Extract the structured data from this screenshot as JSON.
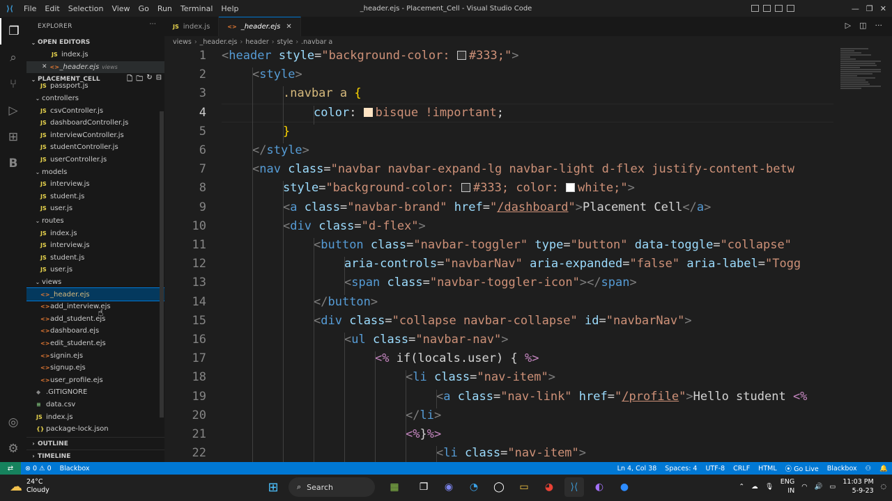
{
  "titlebar": {
    "menu": [
      "File",
      "Edit",
      "Selection",
      "View",
      "Go",
      "Run",
      "Terminal",
      "Help"
    ],
    "title": "_header.ejs - Placement_Cell - Visual Studio Code"
  },
  "explorer": {
    "header": "EXPLORER",
    "open_editors_label": "OPEN EDITORS",
    "open_editors": [
      {
        "name": "index.js",
        "type": "JS"
      },
      {
        "name": "_header.ejs",
        "type": "<>",
        "detail": "views"
      }
    ],
    "project_label": "PLACEMENT_CELL",
    "tree": [
      {
        "name": "passport.js",
        "type": "JS",
        "indent": 2
      },
      {
        "name": "controllers",
        "type": "folder",
        "indent": 1
      },
      {
        "name": "csvController.js",
        "type": "JS",
        "indent": 2
      },
      {
        "name": "dashboardController.js",
        "type": "JS",
        "indent": 2
      },
      {
        "name": "interviewController.js",
        "type": "JS",
        "indent": 2
      },
      {
        "name": "studentController.js",
        "type": "JS",
        "indent": 2
      },
      {
        "name": "userController.js",
        "type": "JS",
        "indent": 2
      },
      {
        "name": "models",
        "type": "folder",
        "indent": 1
      },
      {
        "name": "interview.js",
        "type": "JS",
        "indent": 2
      },
      {
        "name": "student.js",
        "type": "JS",
        "indent": 2
      },
      {
        "name": "user.js",
        "type": "JS",
        "indent": 2
      },
      {
        "name": "routes",
        "type": "folder",
        "indent": 1
      },
      {
        "name": "index.js",
        "type": "JS",
        "indent": 2
      },
      {
        "name": "interview.js",
        "type": "JS",
        "indent": 2
      },
      {
        "name": "student.js",
        "type": "JS",
        "indent": 2
      },
      {
        "name": "user.js",
        "type": "JS",
        "indent": 2
      },
      {
        "name": "views",
        "type": "folder",
        "indent": 1
      },
      {
        "name": "_header.ejs",
        "type": "<>",
        "indent": 2,
        "selected": true
      },
      {
        "name": "add_interview.ejs",
        "type": "<>",
        "indent": 2
      },
      {
        "name": "add_student.ejs",
        "type": "<>",
        "indent": 2
      },
      {
        "name": "dashboard.ejs",
        "type": "<>",
        "indent": 2
      },
      {
        "name": "edit_student.ejs",
        "type": "<>",
        "indent": 2
      },
      {
        "name": "signin.ejs",
        "type": "<>",
        "indent": 2
      },
      {
        "name": "signup.ejs",
        "type": "<>",
        "indent": 2
      },
      {
        "name": "user_profile.ejs",
        "type": "<>",
        "indent": 2
      },
      {
        "name": ".GITIGNORE",
        "type": "plain",
        "indent": 1
      },
      {
        "name": "data.csv",
        "type": "csv",
        "indent": 1
      },
      {
        "name": "index.js",
        "type": "JS",
        "indent": 1
      },
      {
        "name": "package-lock.json",
        "type": "{}",
        "indent": 1
      }
    ],
    "outline_label": "OUTLINE",
    "timeline_label": "TIMELINE"
  },
  "tabs": [
    {
      "label": "index.js",
      "type": "JS"
    },
    {
      "label": "_header.ejs",
      "type": "<>",
      "active": true
    }
  ],
  "breadcrumb": [
    "views",
    "_header.ejs",
    "header",
    "style",
    ".navbar a"
  ],
  "code_lines": [
    {
      "n": 1,
      "i": 0,
      "html": "<span class='p'>&lt;</span><span class='t'>header</span> <span class='a'>style</span><span class='txt'>=</span><span class='s'>\"background-color: <span class='sw' style='background:#333'></span>#333;\"</span><span class='p'>&gt;</span>"
    },
    {
      "n": 2,
      "i": 1,
      "html": "<span class='p'>&lt;</span><span class='t'>style</span><span class='p'>&gt;</span>"
    },
    {
      "n": 3,
      "i": 2,
      "html": "<span class='sel'>.navbar a</span> <span class='br'>{</span>"
    },
    {
      "n": 4,
      "i": 3,
      "html": "<span class='a'>color</span><span class='txt'>: </span><span class='sw' style='background:#ffe4c4;border-color:#ffe4c4'></span><span class='s'>bisque</span> <span class='s'>!important</span><span class='txt'>;</span>"
    },
    {
      "n": 5,
      "i": 2,
      "html": "<span class='br'>}</span>"
    },
    {
      "n": 6,
      "i": 1,
      "html": "<span class='p'>&lt;/</span><span class='t'>style</span><span class='p'>&gt;</span>"
    },
    {
      "n": 7,
      "i": 1,
      "html": "<span class='p'>&lt;</span><span class='t'>nav</span> <span class='a'>class</span><span class='txt'>=</span><span class='s'>\"navbar navbar-expand-lg navbar-light d-flex justify-content-betw</span>"
    },
    {
      "n": 8,
      "i": 2,
      "html": "<span class='a'>style</span><span class='txt'>=</span><span class='s'>\"background-color: <span class='sw' style='background:#333'></span>#333; color: <span class='sw' style='background:#fff'></span>white;\"</span><span class='p'>&gt;</span>"
    },
    {
      "n": 9,
      "i": 2,
      "html": "<span class='p'>&lt;</span><span class='t'>a</span> <span class='a'>class</span><span class='txt'>=</span><span class='s'>\"navbar-brand\"</span> <span class='a'>href</span><span class='txt'>=</span><span class='s'>\"</span><span class='u'>/dashboard</span><span class='s'>\"</span><span class='p'>&gt;</span><span class='txt'>Placement Cell</span><span class='p'>&lt;/</span><span class='t'>a</span><span class='p'>&gt;</span>"
    },
    {
      "n": 10,
      "i": 2,
      "html": "<span class='p'>&lt;</span><span class='t'>div</span> <span class='a'>class</span><span class='txt'>=</span><span class='s'>\"d-flex\"</span><span class='p'>&gt;</span>"
    },
    {
      "n": 11,
      "i": 3,
      "html": "<span class='p'>&lt;</span><span class='t'>button</span> <span class='a'>class</span><span class='txt'>=</span><span class='s'>\"navbar-toggler\"</span> <span class='a'>type</span><span class='txt'>=</span><span class='s'>\"button\"</span> <span class='a'>data-toggle</span><span class='txt'>=</span><span class='s'>\"collapse\"</span>"
    },
    {
      "n": 12,
      "i": 4,
      "html": "<span class='a'>aria-controls</span><span class='txt'>=</span><span class='s'>\"navbarNav\"</span> <span class='a'>aria-expanded</span><span class='txt'>=</span><span class='s'>\"false\"</span> <span class='a'>aria-label</span><span class='txt'>=</span><span class='s'>\"Togg</span>"
    },
    {
      "n": 13,
      "i": 4,
      "html": "<span class='p'>&lt;</span><span class='t'>span</span> <span class='a'>class</span><span class='txt'>=</span><span class='s'>\"navbar-toggler-icon\"</span><span class='p'>&gt;&lt;/</span><span class='t'>span</span><span class='p'>&gt;</span>"
    },
    {
      "n": 14,
      "i": 3,
      "html": "<span class='p'>&lt;/</span><span class='t'>button</span><span class='p'>&gt;</span>"
    },
    {
      "n": 15,
      "i": 3,
      "html": "<span class='p'>&lt;</span><span class='t'>div</span> <span class='a'>class</span><span class='txt'>=</span><span class='s'>\"collapse navbar-collapse\"</span> <span class='a'>id</span><span class='txt'>=</span><span class='s'>\"navbarNav\"</span><span class='p'>&gt;</span>"
    },
    {
      "n": 16,
      "i": 4,
      "html": "<span class='p'>&lt;</span><span class='t'>ul</span> <span class='a'>class</span><span class='txt'>=</span><span class='s'>\"navbar-nav\"</span><span class='p'>&gt;</span>"
    },
    {
      "n": 17,
      "i": 5,
      "html": "<span class='kw'>&lt;%</span><span class='txt'> if(locals.user) { </span><span class='kw'>%&gt;</span>"
    },
    {
      "n": 18,
      "i": 6,
      "html": "<span class='p'>&lt;</span><span class='t'>li</span> <span class='a'>class</span><span class='txt'>=</span><span class='s'>\"nav-item\"</span><span class='p'>&gt;</span>"
    },
    {
      "n": 19,
      "i": 7,
      "html": "<span class='p'>&lt;</span><span class='t'>a</span> <span class='a'>class</span><span class='txt'>=</span><span class='s'>\"nav-link\"</span> <span class='a'>href</span><span class='txt'>=</span><span class='s'>\"</span><span class='u'>/profile</span><span class='s'>\"</span><span class='p'>&gt;</span><span class='txt'>Hello student </span><span class='kw'>&lt;%</span>"
    },
    {
      "n": 20,
      "i": 6,
      "html": "<span class='p'>&lt;/</span><span class='t'>li</span><span class='p'>&gt;</span>"
    },
    {
      "n": 21,
      "i": 6,
      "html": "<span class='kw'>&lt;%</span><span class='txt'>}</span><span class='kw'>%&gt;</span>"
    },
    {
      "n": 22,
      "i": 7,
      "html": "<span class='p'>&lt;</span><span class='t'>li</span> <span class='a'>class</span><span class='txt'>=</span><span class='s'>\"nav-item\"</span><span class='p'>&gt;</span>"
    }
  ],
  "statusbar": {
    "problems": "⊗ 0 ⚠ 0",
    "ext": "Blackbox",
    "position": "Ln 4, Col 38",
    "spaces": "Spaces: 4",
    "encoding": "UTF-8",
    "eol": "CRLF",
    "language": "HTML",
    "golive": "Go Live",
    "blackbox": "Blackbox"
  },
  "taskbar": {
    "temp": "24°C",
    "weather": "Cloudy",
    "search": "Search",
    "lang1": "ENG",
    "lang2": "IN",
    "time": "11:03 PM",
    "date": "5-9-23"
  }
}
